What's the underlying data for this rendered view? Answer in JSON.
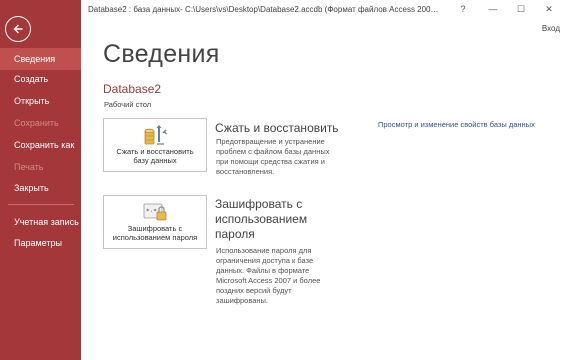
{
  "window": {
    "title": "Database2 : база данных- C:\\Users\\vs\\Desktop\\Database2.accdb (Формат файлов Access 2007–2016...",
    "help_label": "?",
    "minimize_label": "—",
    "maximize_label": "☐",
    "close_label": "✕",
    "signin_label": "Вход"
  },
  "sidebar": {
    "items": [
      {
        "label": "Сведения"
      },
      {
        "label": "Создать"
      },
      {
        "label": "Открыть"
      },
      {
        "label": "Сохранить"
      },
      {
        "label": "Сохранить как"
      },
      {
        "label": "Печать"
      },
      {
        "label": "Закрыть"
      },
      {
        "label": "Учетная запись"
      },
      {
        "label": "Параметры"
      }
    ]
  },
  "main": {
    "page_title": "Сведения",
    "db_name": "Database2",
    "db_path": "Рабочий стол",
    "properties_link": "Просмотр и изменение свойств базы данных",
    "compact": {
      "button_line1": "Сжать и восстановить",
      "button_line2": "базу данных",
      "heading": "Сжать и восстановить",
      "description": "Предотвращение и устранение проблем с файлом базы данных при помощи средства сжатия и восстановления."
    },
    "encrypt": {
      "button_line1": "Зашифровать с",
      "button_line2": "использованием пароля",
      "heading_line1": "Зашифровать с",
      "heading_line2": "использованием",
      "heading_line3": "пароля",
      "description": "Использование пароля для ограничения доступа к базе данных. Файлы в формате Microsoft Access 2007 и более поздних версий будут зашифрованы."
    }
  },
  "colors": {
    "sidebar": "#a4373a",
    "sidebar_active": "#c0504d",
    "accent": "#a4373a",
    "link": "#2b579a"
  }
}
